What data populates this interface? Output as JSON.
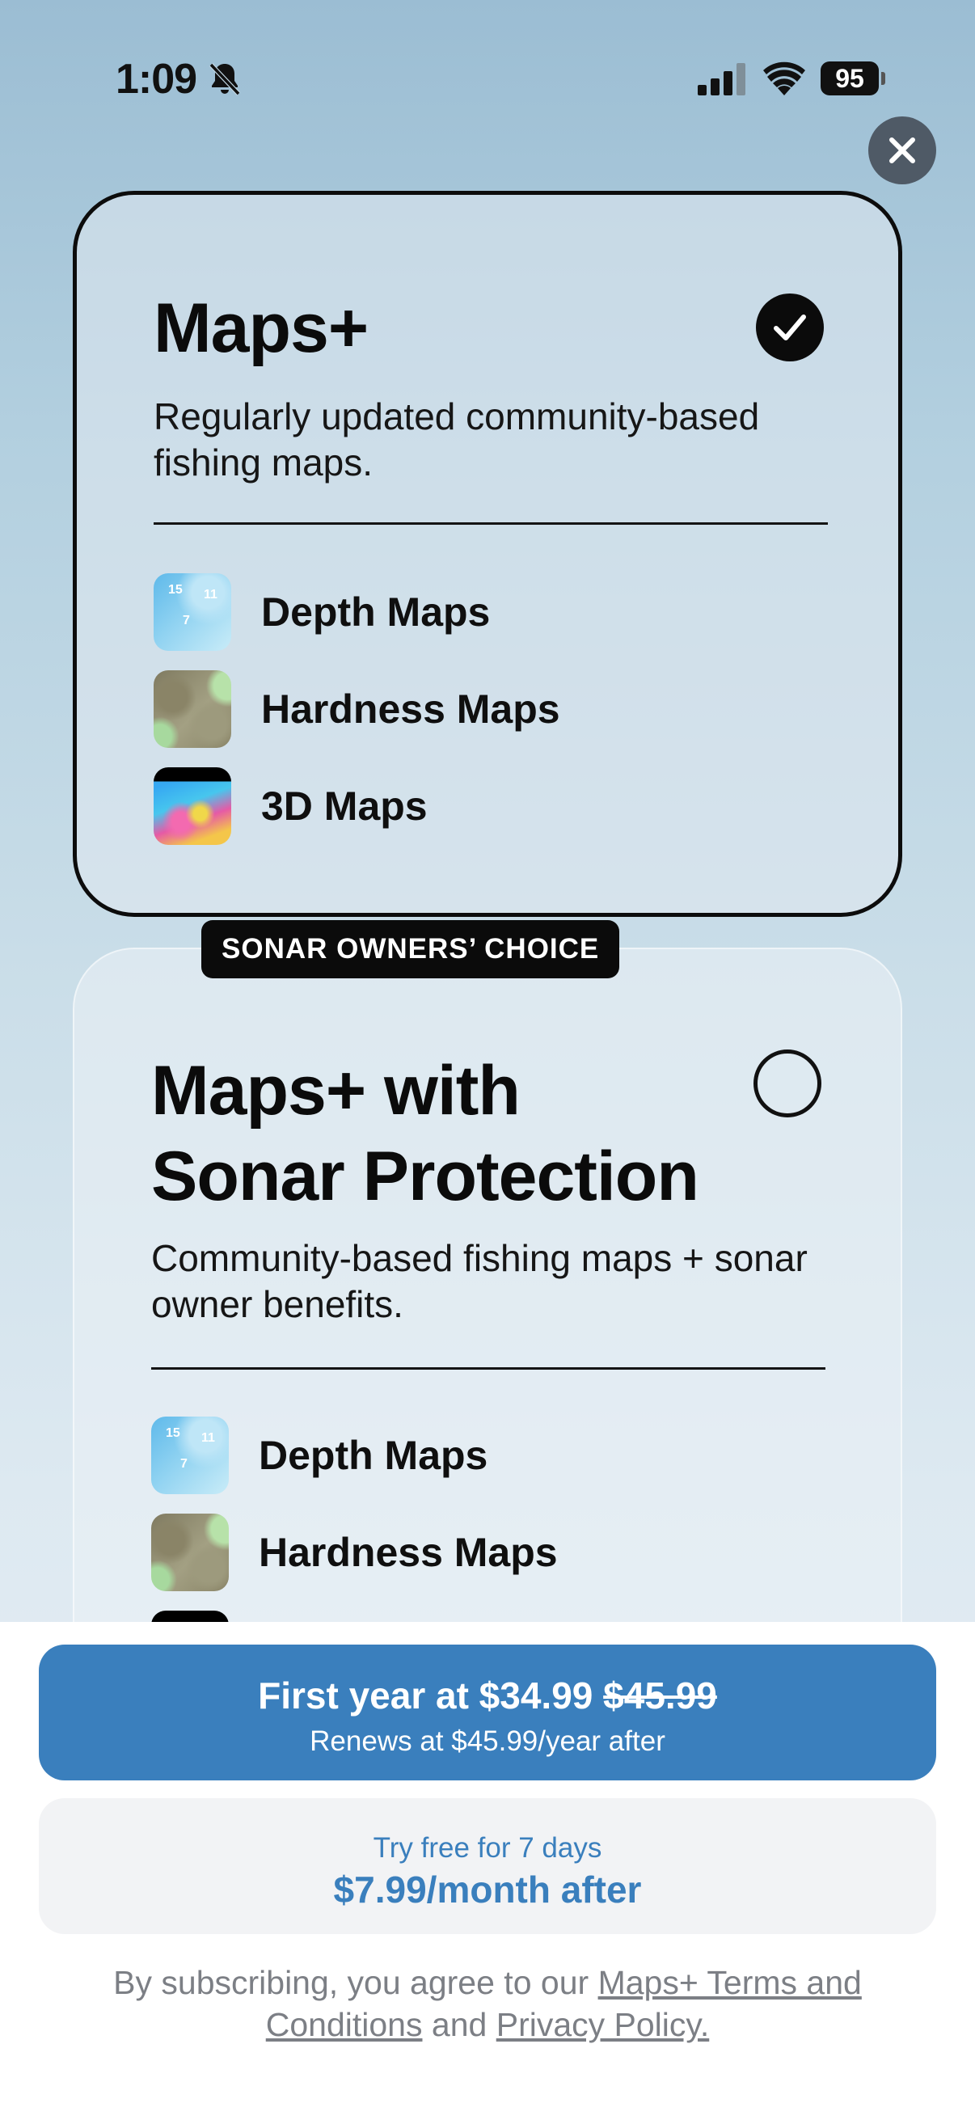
{
  "status_bar": {
    "time": "1:09",
    "battery": "95"
  },
  "plans": [
    {
      "title": "Maps+",
      "description": "Regularly updated community-based fishing maps.",
      "selected": true,
      "features": [
        {
          "label": "Depth Maps",
          "icon": "depth-maps-thumbnail"
        },
        {
          "label": "Hardness Maps",
          "icon": "hardness-maps-thumbnail"
        },
        {
          "label": "3D Maps",
          "icon": "3d-maps-thumbnail"
        }
      ]
    },
    {
      "badge": "SONAR OWNERS’ CHOICE",
      "title_line1": "Maps+ with",
      "title_line2": "Sonar Protection",
      "description": "Community-based fishing maps + sonar owner benefits.",
      "selected": false,
      "features": [
        {
          "label": "Depth Maps",
          "icon": "depth-maps-thumbnail"
        },
        {
          "label": "Hardness Maps",
          "icon": "hardness-maps-thumbnail"
        }
      ]
    }
  ],
  "depth_thumb_numbers": [
    "15",
    "11",
    "7"
  ],
  "purchase": {
    "primary_prefix": "First year at $34.99",
    "primary_strike": "$45.99",
    "primary_sub": "Renews at $45.99/year after",
    "secondary_top": "Try free for 7 days",
    "secondary_main": "$7.99/month after"
  },
  "legal": {
    "prefix": "By subscribing, you agree to our",
    "terms_link": "Maps+ Terms and Conditions",
    "middle": "and",
    "privacy_link": "Privacy Policy."
  },
  "colors": {
    "accent": "#3a7fbd",
    "card_border": "#0c0c0c",
    "close_button": "#4f5a66"
  }
}
